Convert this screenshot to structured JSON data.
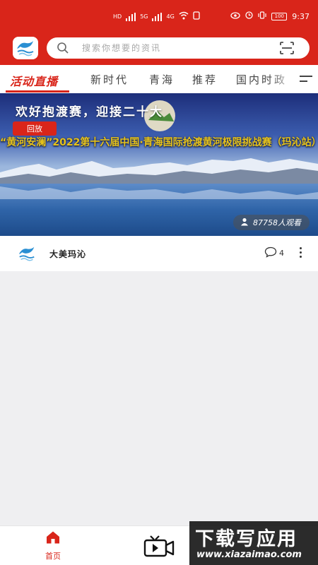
{
  "colors": {
    "brand_red": "#d9251a",
    "gold": "#e6c21a"
  },
  "status_bar": {
    "network_label_1": "HD",
    "network_label_2": "HD",
    "network_5g": "5G",
    "network_4g": "4G",
    "battery": "100",
    "time": "9:37"
  },
  "header": {
    "app_logo": "app-logo-icon",
    "search_placeholder": "搜索你想要的资讯",
    "scan_icon": "scan-icon"
  },
  "tabs": [
    {
      "label": "活动直播",
      "active": true
    },
    {
      "label": "新时代",
      "active": false
    },
    {
      "label": "青海",
      "active": false
    },
    {
      "label": "推荐",
      "active": false
    },
    {
      "label": "国内时政",
      "active": false
    }
  ],
  "banner": {
    "headline": "欢好抱渡赛，迎接二十大",
    "tag": "回放",
    "event_title": "“黄河安澜”2022第十六届中国·青海国际抢渡黄河极限挑战赛（玛沁站）",
    "viewers": "87758人观看"
  },
  "feed": [
    {
      "source": "大美玛沁",
      "comments": "4"
    }
  ],
  "bottom_nav": {
    "home_label": "首页",
    "video_icon": "video-icon"
  },
  "watermark": {
    "title": "下载写应用",
    "url": "www.xiazaimao.com"
  }
}
